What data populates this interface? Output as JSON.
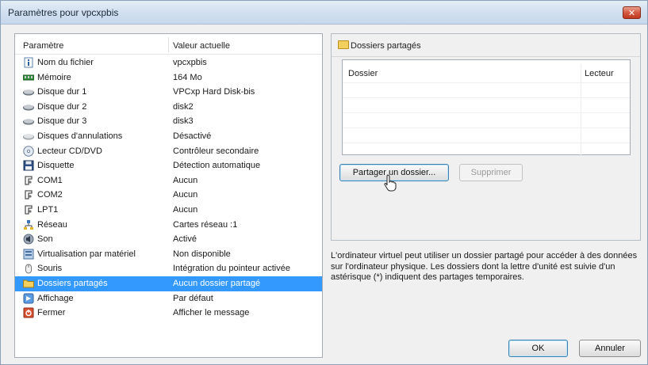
{
  "window": {
    "title": "Paramètres pour vpcxpbis"
  },
  "settings": {
    "headers": {
      "param": "Paramètre",
      "value": "Valeur actuelle"
    },
    "items": [
      {
        "name": "Nom du fichier",
        "value": "vpcxpbis",
        "icon": "info-icon"
      },
      {
        "name": "Mémoire",
        "value": "164 Mo",
        "icon": "memory-icon"
      },
      {
        "name": "Disque dur 1",
        "value": "VPCxp Hard Disk-bis",
        "icon": "hard-disk-icon"
      },
      {
        "name": "Disque dur 2",
        "value": "disk2",
        "icon": "hard-disk-icon"
      },
      {
        "name": "Disque dur 3",
        "value": "disk3",
        "icon": "hard-disk-icon"
      },
      {
        "name": "Disques d'annulations",
        "value": "Désactivé",
        "icon": "undo-disk-icon"
      },
      {
        "name": "Lecteur CD/DVD",
        "value": "Contrôleur secondaire",
        "icon": "cd-dvd-icon"
      },
      {
        "name": "Disquette",
        "value": "Détection automatique",
        "icon": "floppy-icon"
      },
      {
        "name": "COM1",
        "value": "Aucun",
        "icon": "port-icon"
      },
      {
        "name": "COM2",
        "value": "Aucun",
        "icon": "port-icon"
      },
      {
        "name": "LPT1",
        "value": "Aucun",
        "icon": "port-icon"
      },
      {
        "name": "Réseau",
        "value": "Cartes réseau :1",
        "icon": "network-icon"
      },
      {
        "name": "Son",
        "value": "Activé",
        "icon": "sound-icon"
      },
      {
        "name": "Virtualisation par matériel",
        "value": "Non disponible",
        "icon": "hardware-virtualization-icon"
      },
      {
        "name": "Souris",
        "value": "Intégration du pointeur activée",
        "icon": "mouse-icon"
      },
      {
        "name": "Dossiers partagés",
        "value": "Aucun dossier partagé",
        "icon": "shared-folder-icon",
        "selected": true
      },
      {
        "name": "Affichage",
        "value": "Par défaut",
        "icon": "display-icon"
      },
      {
        "name": "Fermer",
        "value": "Afficher le message",
        "icon": "close-setting-icon"
      }
    ]
  },
  "shared_folders": {
    "title": "Dossiers partagés",
    "table_headers": {
      "folder": "Dossier",
      "drive": "Lecteur"
    },
    "share_button": "Partager un dossier...",
    "delete_button": "Supprimer",
    "info": "L'ordinateur virtuel peut utiliser un dossier partagé pour accéder à des données sur l'ordinateur physique. Les dossiers dont la lettre d'unité est suivie d'un astérisque (*) indiquent des partages temporaires."
  },
  "footer": {
    "ok": "OK",
    "cancel": "Annuler"
  }
}
